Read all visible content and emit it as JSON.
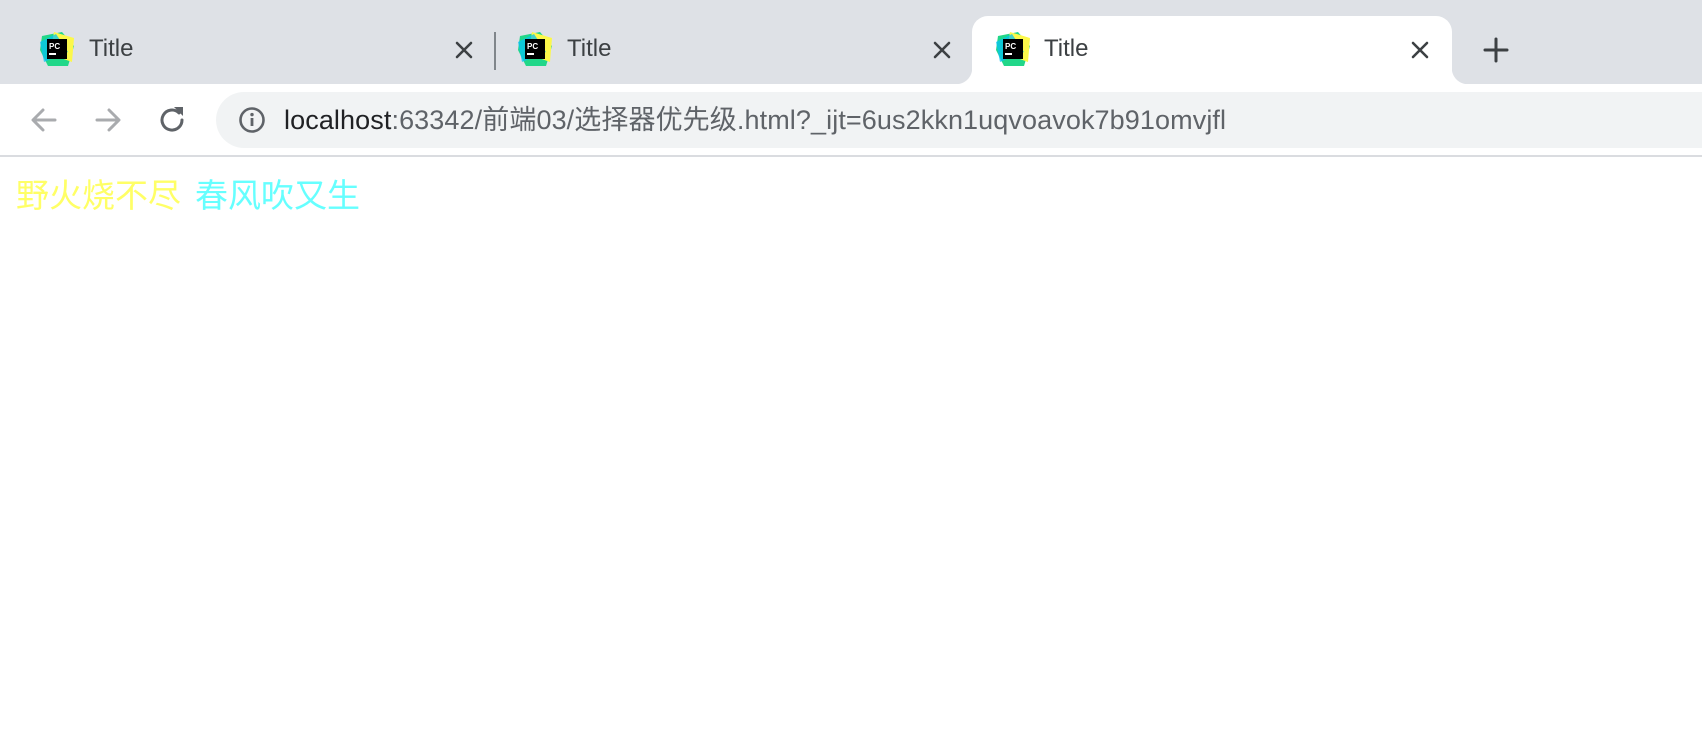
{
  "tabs": [
    {
      "title": "Title",
      "active": false
    },
    {
      "title": "Title",
      "active": false
    },
    {
      "title": "Title",
      "active": true
    }
  ],
  "toolbar": {
    "back_icon": "arrow-left-icon",
    "forward_icon": "arrow-right-icon",
    "reload_icon": "reload-icon",
    "url_host": "localhost",
    "url_rest": ":63342/前端03/选择器优先级.html?_ijt=6us2kkn1uqvoavok7b91omvjfl"
  },
  "page": {
    "text_1": "野火烧不尽",
    "text_1_color": "#ffff66",
    "text_2": "春风吹又生",
    "text_2_color": "#66ffff"
  },
  "colors": {
    "tabstrip_bg": "#dee1e6",
    "omnibox_bg": "#f1f3f4"
  }
}
